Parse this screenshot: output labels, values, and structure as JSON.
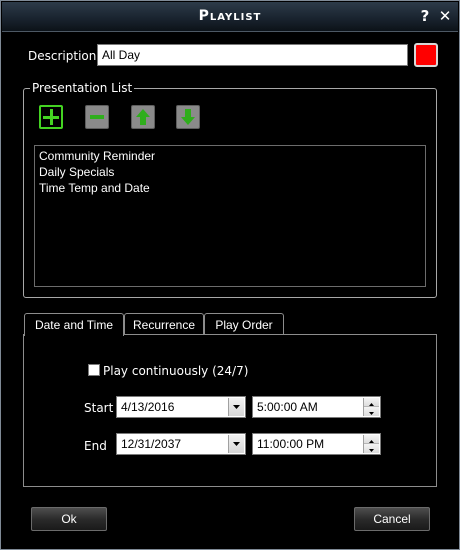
{
  "window": {
    "title": "Playlist",
    "help_label": "?",
    "close_label": "✕"
  },
  "description": {
    "label": "Description:",
    "value": "All Day",
    "color": "#ff0000"
  },
  "presentation_list": {
    "legend": "Presentation List",
    "toolbar": {
      "add_icon": "plus-icon",
      "remove_icon": "minus-icon",
      "up_icon": "arrow-up-icon",
      "down_icon": "arrow-down-icon"
    },
    "items": [
      "Community Reminder",
      "Daily Specials",
      "Time Temp and Date"
    ]
  },
  "tabs": [
    {
      "label": "Date and Time",
      "active": true
    },
    {
      "label": "Recurrence",
      "active": false
    },
    {
      "label": "Play Order",
      "active": false
    }
  ],
  "date_time": {
    "play_continuously_label": "Play continuously (24/7)",
    "play_continuously_checked": false,
    "start_label": "Start",
    "start_date": "4/13/2016",
    "start_time": "5:00:00 AM",
    "end_label": "End",
    "end_date": "12/31/2037",
    "end_time": "11:00:00 PM"
  },
  "buttons": {
    "ok": "Ok",
    "cancel": "Cancel"
  }
}
